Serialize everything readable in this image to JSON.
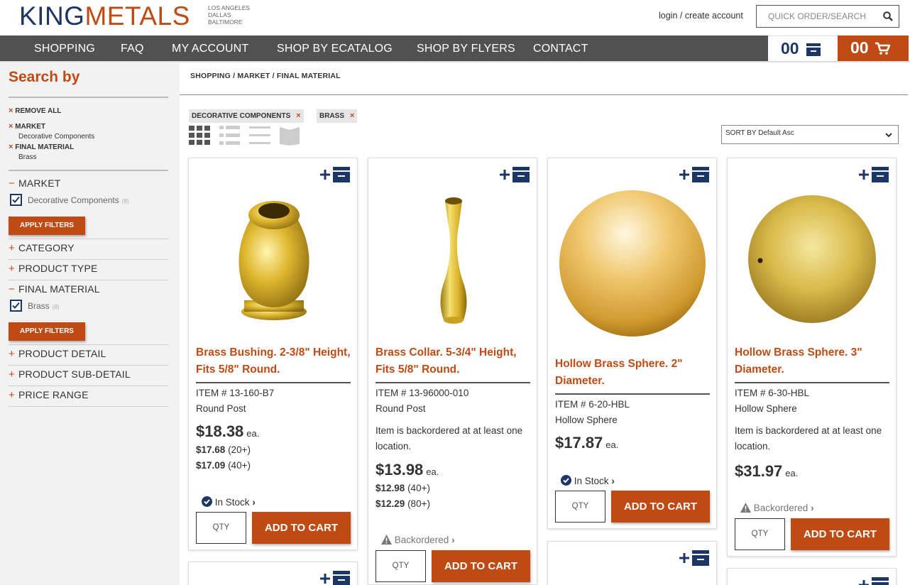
{
  "header": {
    "logo_king": "KING",
    "logo_metals": "METALS",
    "cities": [
      "LOS ANGELES",
      "DALLAS",
      "BALTIMORE"
    ],
    "login_text": "login / create account",
    "search_placeholder": "QUICK ORDER/SEARCH",
    "quick_count": "00",
    "cart_count": "00"
  },
  "nav": {
    "items": [
      "SHOPPING",
      "FAQ",
      "MY ACCOUNT",
      "SHOP BY ECATALOG",
      "SHOP BY FLYERS",
      "CONTACT"
    ]
  },
  "sidebar": {
    "title": "Search by",
    "remove_all": "REMOVE ALL",
    "active": [
      {
        "label": "MARKET",
        "value": "Decorative Components"
      },
      {
        "label": "FINAL MATERIAL",
        "value": "Brass"
      }
    ],
    "market": {
      "label": "MARKET",
      "option": "Decorative Components",
      "count": "(8)"
    },
    "apply_label": "APPLY FILTERS",
    "category": "CATEGORY",
    "product_type": "PRODUCT TYPE",
    "final_material": {
      "label": "FINAL MATERIAL",
      "option": "Brass",
      "count": "(8)"
    },
    "product_detail": "PRODUCT DETAIL",
    "product_sub_detail": "PRODUCT SUB-DETAIL",
    "price_range": "PRICE RANGE",
    "plus": "+",
    "minus": "−",
    "x": "×"
  },
  "main": {
    "breadcrumb": "SHOPPING / MARKET / FINAL MATERIAL",
    "chips": [
      "DECORATIVE COMPONENTS",
      "BRASS"
    ],
    "sort_label": "SORT BY Default Asc",
    "products": [
      {
        "name": "Brass Bushing. 2-3/8\" Height, Fits 5/8\" Round.",
        "item": "ITEM # 13-160-B7",
        "type": "Round Post",
        "backorder_note": "",
        "price": "$18.38",
        "ea": "ea.",
        "tiers": [
          {
            "price": "$17.68",
            "qty": "(20+)"
          },
          {
            "price": "$17.09",
            "qty": "(40+)"
          }
        ],
        "status": "In Stock",
        "qty_placeholder": "QTY",
        "add_label": "ADD TO CART"
      },
      {
        "name": "Brass Collar. 5-3/4\" Height, Fits 5/8\" Round.",
        "item": "ITEM # 13-96000-010",
        "type": "Round Post",
        "backorder_note": "Item is backordered at at least one location.",
        "price": "$13.98",
        "ea": "ea.",
        "tiers": [
          {
            "price": "$12.98",
            "qty": "(40+)"
          },
          {
            "price": "$12.29",
            "qty": "(80+)"
          }
        ],
        "status": "Backordered",
        "qty_placeholder": "QTY",
        "add_label": "ADD TO CART"
      },
      {
        "name": "Hollow Brass Sphere. 2\" Diameter.",
        "item": "ITEM # 6-20-HBL",
        "type": "Hollow Sphere",
        "backorder_note": "",
        "price": "$17.87",
        "ea": "ea.",
        "tiers": [],
        "status": "In Stock",
        "qty_placeholder": "QTY",
        "add_label": "ADD TO CART"
      },
      {
        "name": "Hollow Brass Sphere. 3\" Diameter.",
        "item": "ITEM # 6-30-HBL",
        "type": "Hollow Sphere",
        "backorder_note": "Item is backordered at at least one location.",
        "price": "$31.97",
        "ea": "ea.",
        "tiers": [],
        "status": "Backordered",
        "qty_placeholder": "QTY",
        "add_label": "ADD TO CART"
      }
    ]
  },
  "colors": {
    "brand_orange": "#c04a14",
    "brand_navy": "#1c3667",
    "nav_bg": "#515151"
  }
}
